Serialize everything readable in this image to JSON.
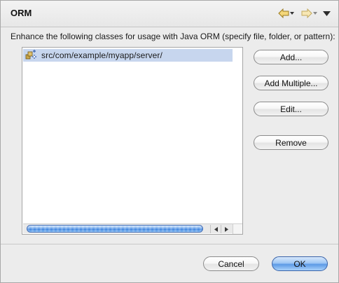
{
  "dialog": {
    "title": "ORM",
    "description": "Enhance the following classes for usage with Java ORM (specify file, folder, or pattern):"
  },
  "nav": {
    "back_icon": "arrow-left-icon",
    "forward_icon": "arrow-right-icon",
    "menu_icon": "triangle-down-icon"
  },
  "list": {
    "items": [
      {
        "label": "src/com/example/myapp/server/",
        "icon": "package-pattern-icon",
        "selected": true
      }
    ],
    "scroll_position": 0
  },
  "buttons": {
    "add": "Add...",
    "add_multiple": "Add Multiple...",
    "edit": "Edit...",
    "remove": "Remove",
    "cancel": "Cancel",
    "ok": "OK"
  },
  "colors": {
    "selection": "#c7d6ee",
    "default_button": "#5c9ae6",
    "scroll_thumb": "#3f84de"
  }
}
